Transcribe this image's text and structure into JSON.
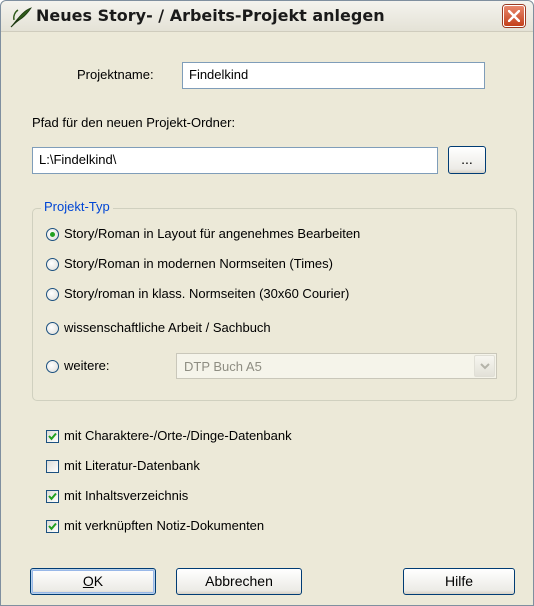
{
  "window": {
    "title": "Neues Story- / Arbeits-Projekt anlegen",
    "app_icon": "quill-pen-icon",
    "close_icon": "close-icon"
  },
  "form": {
    "project_name_label": "Projektname:",
    "project_name_value": "Findelkind",
    "path_label": "Pfad für den neuen Projekt-Ordner:",
    "path_value": "L:\\Findelkind\\",
    "browse_label": "..."
  },
  "project_type": {
    "legend": "Projekt-Typ",
    "options": [
      {
        "label": "Story/Roman in Layout für angenehmes Bearbeiten",
        "checked": true
      },
      {
        "label": "Story/Roman in modernen Normseiten (Times)",
        "checked": false
      },
      {
        "label": "Story/roman in klass. Normseiten (30x60 Courier)",
        "checked": false
      },
      {
        "label": "wissenschaftliche Arbeit / Sachbuch",
        "checked": false
      },
      {
        "label": "weitere:",
        "checked": false
      }
    ],
    "more_select": {
      "value": "DTP Buch A5",
      "disabled": true
    }
  },
  "options": {
    "checkboxes": [
      {
        "label": "mit Charaktere-/Orte-/Dinge-Datenbank",
        "checked": true
      },
      {
        "label": "mit Literatur-Datenbank",
        "checked": false
      },
      {
        "label": "mit Inhaltsverzeichnis",
        "checked": true
      },
      {
        "label": "mit verknüpften Notiz-Dokumenten",
        "checked": true
      }
    ]
  },
  "buttons": {
    "ok_accel": "O",
    "ok_rest": "K",
    "cancel": "Abbrechen",
    "help": "Hilfe"
  },
  "colors": {
    "dialog_bg": "#ece9d8",
    "group_legend": "#0046d5",
    "close_button": "#c3401b",
    "checkmark": "#21a121"
  }
}
